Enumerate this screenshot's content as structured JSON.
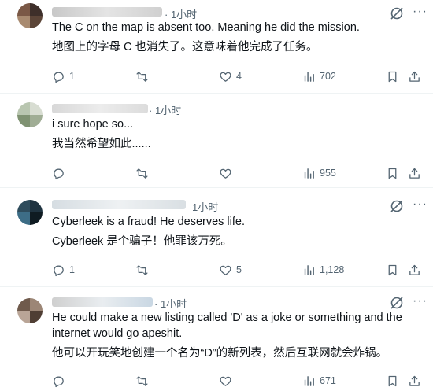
{
  "replies": [
    {
      "time": "· 1小时",
      "text_en": "The C on the map is absent too. Meaning he did the mission.",
      "text_zh": "地图上的字母 C 也消失了。这意味着他完成了任务。",
      "replies": "1",
      "reposts": "",
      "likes": "4",
      "views": "702"
    },
    {
      "time": "· 1小时",
      "text_en": "i sure hope so...",
      "text_zh": "我当然希望如此......",
      "replies": "",
      "reposts": "",
      "likes": "",
      "views": "955"
    },
    {
      "time": "1小时",
      "text_en": "Cyberleek is a fraud! He deserves life.",
      "text_zh": "Cyberleek 是个骗子！他罪该万死。",
      "replies": "1",
      "reposts": "",
      "likes": "5",
      "views": "1,128"
    },
    {
      "time": "· 1小时",
      "text_en_1": "He could make a new listing called 'D' as a joke or something and the",
      "text_en_2": "internet would go apeshit.",
      "text_zh": "他可以开玩笑地创建一个名为“D”的新列表，然后互联网就会炸锅。",
      "replies": "",
      "reposts": "",
      "likes": "",
      "views": "671"
    }
  ],
  "colors": {
    "text": "#0f1419",
    "muted": "#536471",
    "divider": "#eff3f4",
    "verified": "#1d9bf0"
  },
  "icons": [
    "reply-icon",
    "repost-icon",
    "like-icon",
    "views-icon",
    "bookmark-icon",
    "share-icon",
    "grok-icon",
    "more-icon"
  ]
}
